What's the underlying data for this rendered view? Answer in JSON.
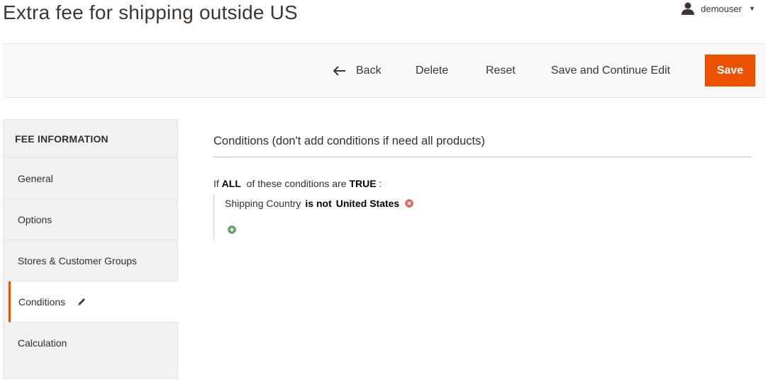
{
  "page": {
    "title": "Extra fee for shipping outside US"
  },
  "header": {
    "user_name": "demouser",
    "user_icon": "user-icon"
  },
  "toolbar": {
    "back_label": "Back",
    "delete_label": "Delete",
    "reset_label": "Reset",
    "save_continue_label": "Save and Continue Edit",
    "save_label": "Save",
    "accent_color": "#eb5202"
  },
  "sidebar": {
    "section_title": "FEE INFORMATION",
    "items": [
      {
        "label": "General"
      },
      {
        "label": "Options"
      },
      {
        "label": "Stores & Customer Groups"
      },
      {
        "label": "Conditions",
        "active": true
      },
      {
        "label": "Calculation"
      }
    ]
  },
  "main": {
    "heading": "Conditions (don't add conditions if need all products)",
    "rule": {
      "prefix": "If",
      "aggregator": "ALL",
      "middle": "of these conditions are",
      "value": "TRUE",
      "suffix": ":",
      "conditions": [
        {
          "attribute": "Shipping Country",
          "operator": "is not",
          "value": "United States"
        }
      ]
    }
  }
}
